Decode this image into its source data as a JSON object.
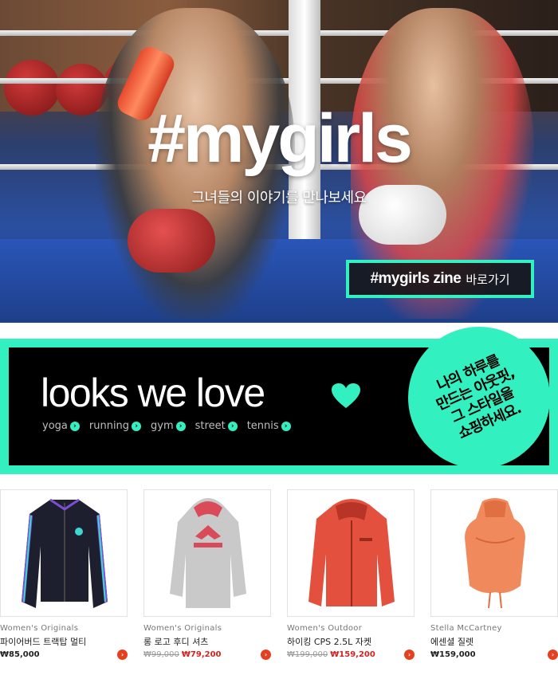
{
  "hero": {
    "title": "#mygirls",
    "subtitle": "그녀들의 이야기를 만나보세요",
    "zine_button": {
      "tag": "#mygirls zine",
      "go_label": "바로가기"
    },
    "accent_color": "#33f0c0"
  },
  "looks": {
    "title": "looks we love",
    "heart_icon": "heart-icon",
    "categories": [
      {
        "label": "yoga"
      },
      {
        "label": "running"
      },
      {
        "label": "gym"
      },
      {
        "label": "street"
      },
      {
        "label": "tennis"
      }
    ],
    "circle_lines": [
      "나의 하루를",
      "만드는 아웃핏,",
      "그 스타일을",
      "쇼핑하세요."
    ]
  },
  "products": [
    {
      "brand": "Women's Originals",
      "name": "파이어버드 트랙탑 멀티",
      "price_regular": "₩85,000",
      "price_old": "",
      "price_sale": "",
      "image": "black track jacket"
    },
    {
      "brand": "Women's Originals",
      "name": "롱 로고 후디 셔츠",
      "price_regular": "",
      "price_old": "₩99,000",
      "price_sale": "₩79,200",
      "image": "grey adidas hoodie"
    },
    {
      "brand": "Women's Outdoor",
      "name": "하이킹 CPS 2.5L 자켓",
      "price_regular": "",
      "price_old": "₩199,000",
      "price_sale": "₩159,200",
      "image": "red outdoor jacket"
    },
    {
      "brand": "Stella McCartney",
      "name": "에센셜 질렛",
      "price_regular": "₩159,000",
      "price_old": "",
      "price_sale": "",
      "image": "coral hooded vest"
    }
  ]
}
